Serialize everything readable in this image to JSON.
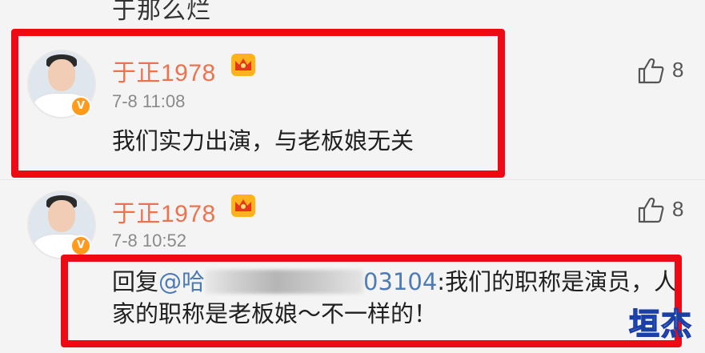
{
  "top_fragment": "于那么烂",
  "comments": [
    {
      "username": "于正1978",
      "time": "7-8 11:08",
      "text": "我们实力出演，与老板娘无关",
      "likes": "8",
      "verified": "V"
    },
    {
      "username": "于正1978",
      "time": "7-8 10:52",
      "reply_prefix": "回复",
      "mention_visible_start": "@哈",
      "mention_visible_end": "03104",
      "reply_line1_rest": ":我们的职称是演员，人",
      "reply_line2": "家的职称是老板娘～不一样的！",
      "likes": "8",
      "verified": "V"
    }
  ],
  "watermark": "垣杰",
  "colors": {
    "username": "#eb7350",
    "highlight": "#ee0a14",
    "mention": "#4c7bb5",
    "verified_badge": "#ff9a1a"
  },
  "icons": {
    "like": "thumbs-up-icon",
    "crown": "crown-badge-icon",
    "verified": "verified-v-icon"
  }
}
